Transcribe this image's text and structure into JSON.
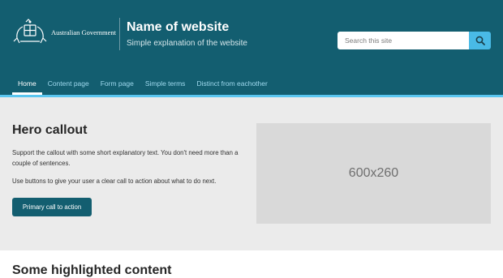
{
  "header": {
    "gov_label": "Australian Government",
    "site_title": "Name of website",
    "site_subtitle": "Simple explanation of the website",
    "search_placeholder": "Search this site",
    "search_icon": "search-icon"
  },
  "nav": {
    "items": [
      {
        "label": "Home",
        "active": true
      },
      {
        "label": "Content page"
      },
      {
        "label": "Form page"
      },
      {
        "label": "Simple terms"
      },
      {
        "label": "Distinct from eachother"
      }
    ]
  },
  "hero": {
    "title": "Hero callout",
    "paragraph1": "Support the callout with some short explanatory text. You don't need more than a couple of sentences.",
    "paragraph2": "Use buttons to give your user a clear call to action about what to do next.",
    "button_label": "Primary call to action",
    "image_placeholder": "600x260"
  },
  "section": {
    "title": "Some highlighted content"
  },
  "colors": {
    "header_bg": "#135e70",
    "accent": "#5ac6f0",
    "nav_text": "#9fd9ee",
    "hero_bg": "#ebebeb",
    "button_bg": "#135e70"
  }
}
